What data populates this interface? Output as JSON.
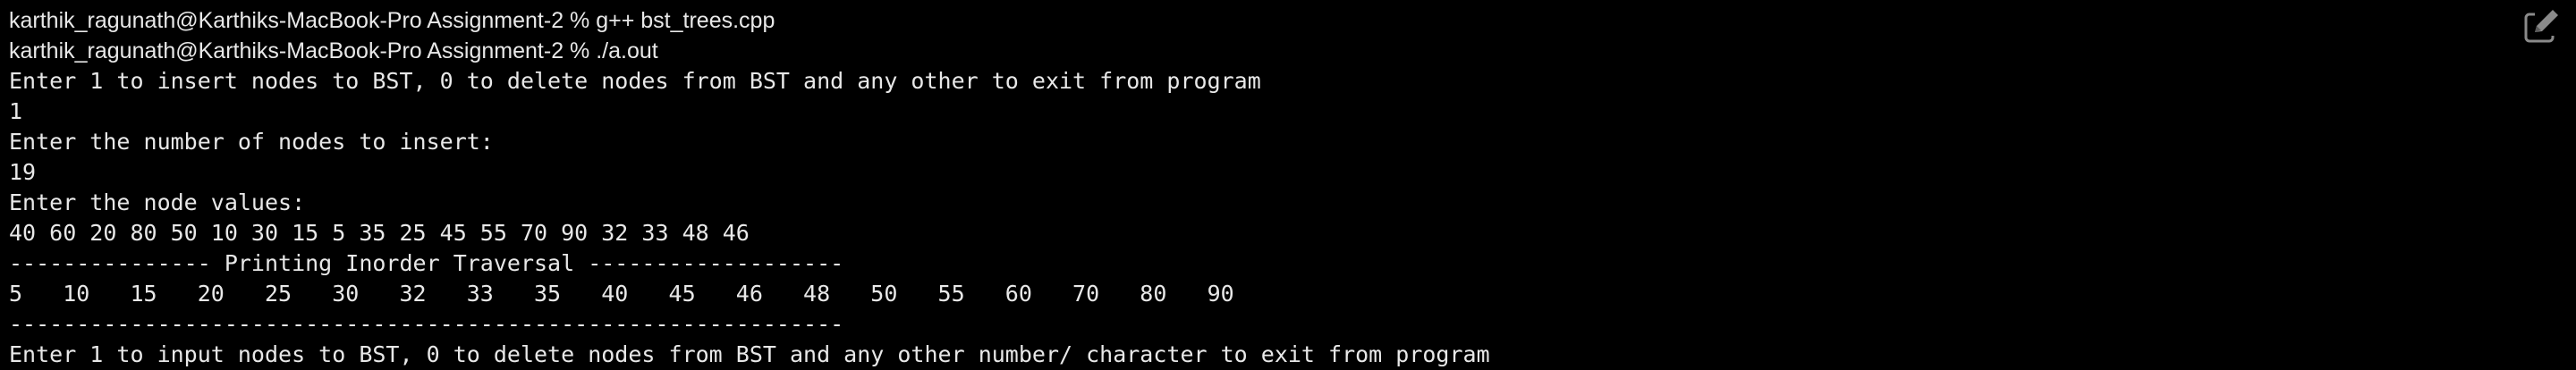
{
  "terminal": {
    "lines": [
      {
        "kind": "prompt",
        "text": "karthik_ragunath@Karthiks-MacBook-Pro Assignment-2 % g++ bst_trees.cpp"
      },
      {
        "kind": "prompt",
        "text": "karthik_ragunath@Karthiks-MacBook-Pro Assignment-2 % ./a.out"
      },
      {
        "kind": "output",
        "text": "Enter 1 to insert nodes to BST, 0 to delete nodes from BST and any other to exit from program"
      },
      {
        "kind": "output",
        "text": "1"
      },
      {
        "kind": "output",
        "text": "Enter the number of nodes to insert:"
      },
      {
        "kind": "output",
        "text": "19"
      },
      {
        "kind": "output",
        "text": "Enter the node values:"
      },
      {
        "kind": "output",
        "text": "40 60 20 80 50 10 30 15 5 35 25 45 55 70 90 32 33 48 46"
      },
      {
        "kind": "output",
        "text": "--------------- Printing Inorder Traversal -------------------"
      },
      {
        "kind": "output",
        "text": "5   10   15   20   25   30   32   33   35   40   45   46   48   50   55   60   70   80   90"
      },
      {
        "kind": "output",
        "text": "--------------------------------------------------------------"
      },
      {
        "kind": "output",
        "text": "Enter 1 to input nodes to BST, 0 to delete nodes from BST and any other number/ character to exit from program"
      }
    ]
  },
  "toolbar": {
    "edit_icon": "edit-icon"
  }
}
